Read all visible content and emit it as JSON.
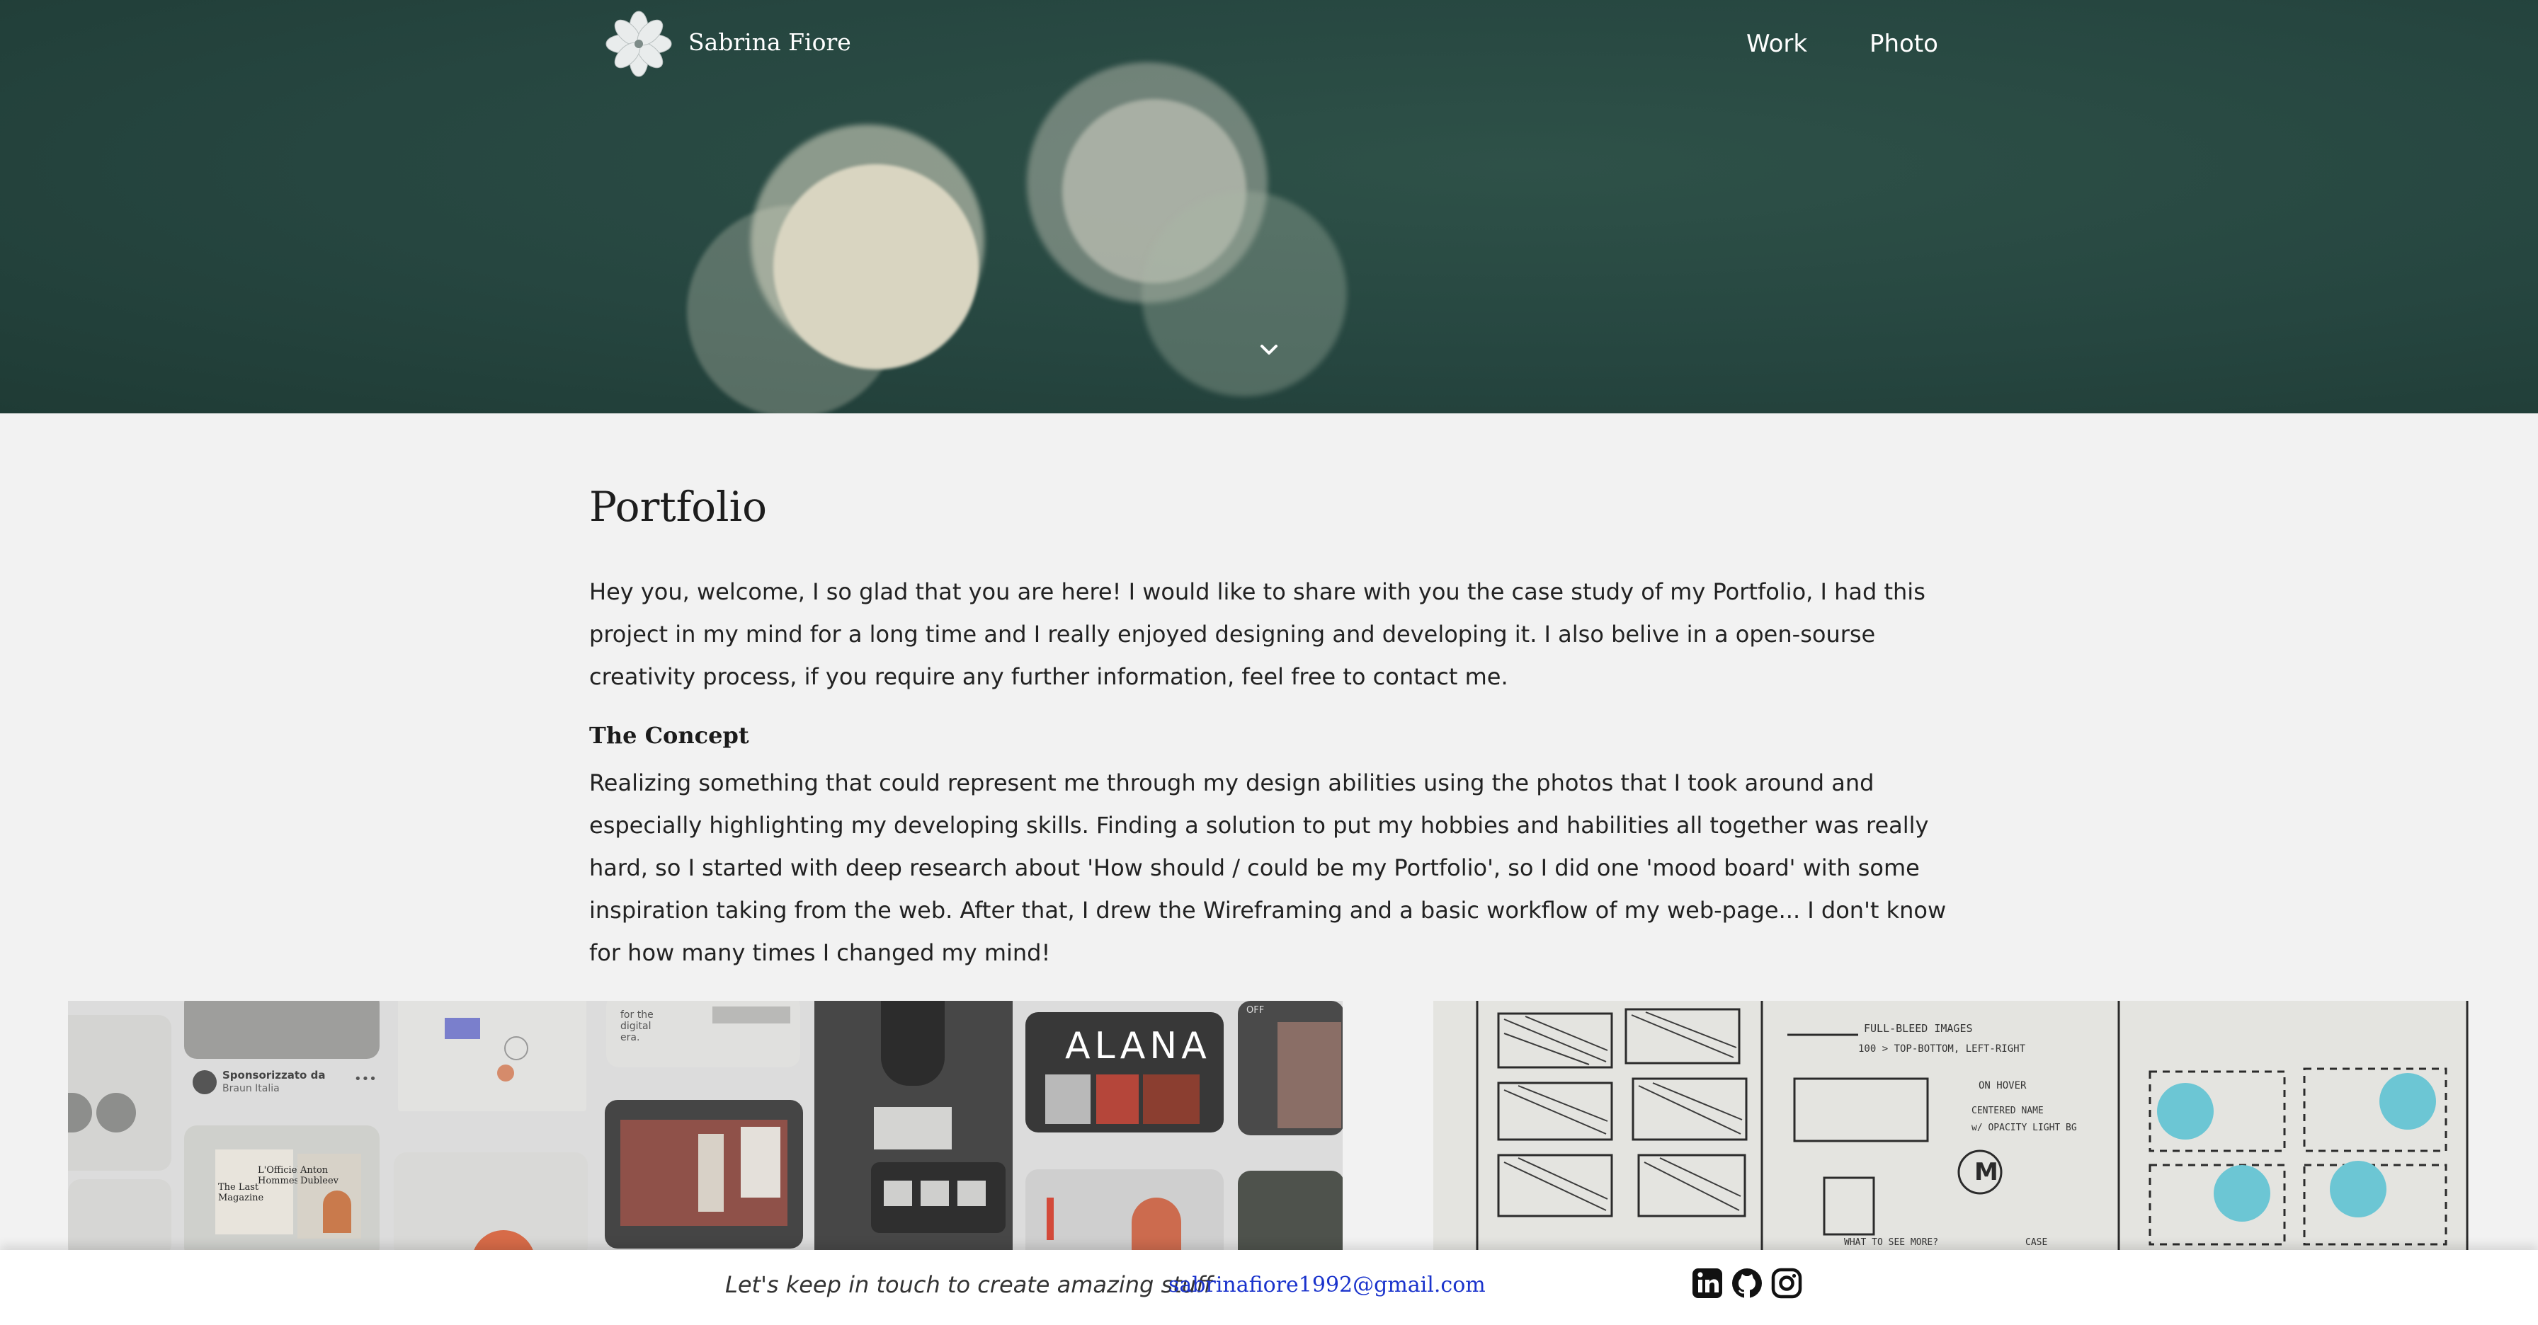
{
  "header": {
    "brand": "Sabrina Fiore",
    "nav": [
      {
        "label": "Work"
      },
      {
        "label": "Photo"
      }
    ]
  },
  "content": {
    "title": "Portfolio",
    "intro": "Hey you, welcome, I so glad that you are here! I would like to share with you the case study of my Portfolio, I had this project in my mind for a long time and I really enjoyed designing and developing it. I also belive in a open-sourse creativity process, if you require any further information, feel free to contact me.",
    "concept_heading": "The Concept",
    "concept_text": "Realizing something that could represent me through my design abilities using the photos that I took around and especially highlighting my developing skills. Finding a solution to put my hobbies and habilities all together was really hard, so I started with deep research about 'How should / could be my Portfolio', so I did one 'mood board' with some inspiration taking from the web. After that, I drew the Wireframing and a basic workflow of my web-page... I don't know for how many times I changed my mind!"
  },
  "moodboard": {
    "sponsored": "Sponsorizzato da",
    "sponsor": "Braun Italia",
    "digital": "for the digital era.",
    "alana": "ALANA",
    "magazine": "The Last Magazine",
    "officiel": "L'Officiel Hommes",
    "anton": "Anton Dubleev",
    "badge": "OFF"
  },
  "sketch": {
    "note1": "FULL-BLEED IMAGES",
    "note2": "100 > TOP-BOTTOM, LEFT-RIGHT",
    "note3": "ON HOVER",
    "note4": "CENTERED NAME",
    "note5": "w/ OPACITY LIGHT BG",
    "note6": "WHAT TO SEE MORE?",
    "note7": "CASE"
  },
  "footer": {
    "tagline": "Let's keep in touch to create amazing stuff",
    "email": "sabrinafiore1992@gmail.com"
  },
  "icons": {
    "logo": "flower-logo-icon",
    "chevron": "chevron-down-icon",
    "linkedin": "linkedin-icon",
    "github": "github-icon",
    "instagram": "instagram-icon"
  },
  "colors": {
    "hero_bg": "#264640",
    "page_bg": "#f2f2f2",
    "link": "#1a33cc"
  }
}
